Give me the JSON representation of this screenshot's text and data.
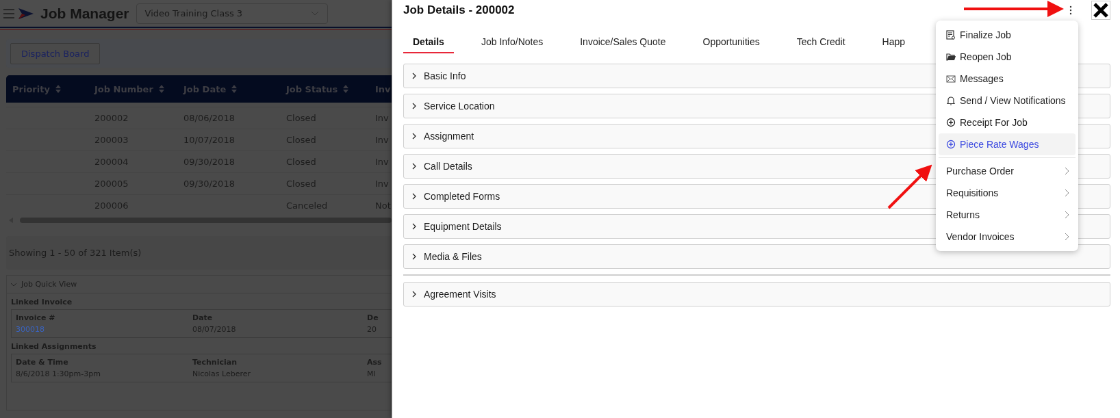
{
  "app": {
    "title": "Job Manager",
    "company_select": "Video Training Class 3",
    "dispatch_button": "Dispatch Board"
  },
  "table": {
    "columns": [
      {
        "label": "Priority"
      },
      {
        "label": "Job Number"
      },
      {
        "label": "Job Date"
      },
      {
        "label": "Job Status"
      },
      {
        "label": "Inv"
      }
    ],
    "rows": [
      [
        "",
        "200002",
        "08/06/2018",
        "Closed",
        "Inv"
      ],
      [
        "",
        "200003",
        "10/07/2018",
        "Closed",
        "Inv"
      ],
      [
        "",
        "200004",
        "09/30/2018",
        "Closed",
        "Inv"
      ],
      [
        "",
        "200005",
        "09/30/2018",
        "Closed",
        "Inv"
      ],
      [
        "",
        "200006",
        "",
        "Canceled",
        "Not"
      ]
    ],
    "paging": "Showing 1 - 50 of 321 Item(s)"
  },
  "quick_view": {
    "title": "Job Quick View",
    "expanded": true,
    "sections": [
      {
        "title": "Linked Invoice",
        "columns": [
          "Invoice #",
          "Date",
          "De"
        ],
        "values": [
          {
            "text": "300018",
            "link": true
          },
          {
            "text": "08/07/2018",
            "link": false
          },
          {
            "text": "20",
            "link": false
          }
        ]
      },
      {
        "title": "Linked Assignments",
        "columns": [
          "Date & Time",
          "Technician",
          "Ass"
        ],
        "values": [
          {
            "text": "8/6/2018 1:30pm-3pm",
            "link": false
          },
          {
            "text": "Nicolas Leberer",
            "link": false
          },
          {
            "text": "MI",
            "link": false
          }
        ]
      }
    ]
  },
  "drawer": {
    "title": "Job Details - 200002",
    "tabs": [
      {
        "label": "Details",
        "selected": true
      },
      {
        "label": "Job Info/Notes",
        "selected": false
      },
      {
        "label": "Invoice/Sales Quote",
        "selected": false
      },
      {
        "label": "Opportunities",
        "selected": false
      },
      {
        "label": "Tech Credit",
        "selected": false
      },
      {
        "label": "Happ",
        "selected": false
      }
    ],
    "sections": [
      {
        "label": "Basic Info",
        "expanded": false
      },
      {
        "label": "Service Location",
        "expanded": false
      },
      {
        "label": "Assignment",
        "expanded": false
      },
      {
        "label": "Call Details",
        "expanded": false
      },
      {
        "label": "Completed Forms",
        "expanded": false
      },
      {
        "label": "Equipment Details",
        "expanded": false
      },
      {
        "label": "Media & Files",
        "expanded": false
      }
    ],
    "extra_sections": [
      {
        "label": "Agreement Visits",
        "expanded": false
      }
    ]
  },
  "menu": {
    "items": [
      {
        "label": "Finalize Job",
        "kind": "action",
        "selected": false
      },
      {
        "label": "Reopen Job",
        "kind": "action",
        "selected": false
      },
      {
        "label": "Messages",
        "kind": "action",
        "selected": false
      },
      {
        "label": "Send / View Notifications",
        "kind": "action",
        "selected": false
      },
      {
        "label": "Receipt For Job",
        "kind": "action",
        "selected": false
      },
      {
        "label": "Piece Rate Wages",
        "kind": "action",
        "selected": true
      },
      {
        "label": "Purchase Order",
        "kind": "submenu",
        "selected": false
      },
      {
        "label": "Requisitions",
        "kind": "submenu",
        "selected": false
      },
      {
        "label": "Returns",
        "kind": "submenu",
        "selected": false
      },
      {
        "label": "Vendor Invoices",
        "kind": "submenu",
        "selected": false
      }
    ]
  }
}
